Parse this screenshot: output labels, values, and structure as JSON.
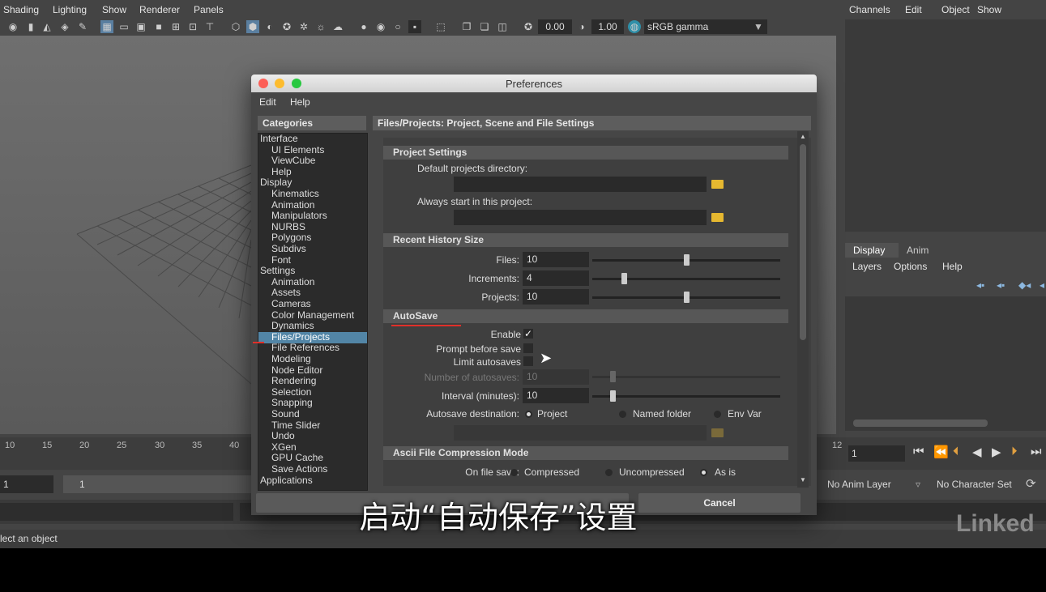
{
  "menubar": {
    "items": [
      "Shading",
      "Lighting",
      "Show",
      "Renderer",
      "Panels"
    ]
  },
  "toolbar": {
    "exposure": "0.00",
    "gamma": "1.00",
    "color_space": "sRGB gamma"
  },
  "right_panel": {
    "menu": [
      "Channels",
      "Edit",
      "Object",
      "Show"
    ],
    "tabs": [
      "Display",
      "Anim"
    ],
    "layer_menu": [
      "Layers",
      "Options",
      "Help"
    ]
  },
  "timeline": {
    "ticks": [
      "10",
      "15",
      "20",
      "25",
      "30",
      "35",
      "40"
    ],
    "right_tick": "12",
    "current_frame": "1"
  },
  "bottom_bar": {
    "start": "1",
    "range_start": "1",
    "anim_layer": "No Anim Layer",
    "character_set": "No Character Set"
  },
  "status": {
    "text": "lect an object"
  },
  "preferences": {
    "title": "Preferences",
    "menu": [
      "Edit",
      "Help"
    ],
    "categories_header": "Categories",
    "settings_header": "Files/Projects: Project, Scene and File Settings",
    "categories": [
      {
        "label": "Interface",
        "indent": 0
      },
      {
        "label": "UI Elements",
        "indent": 1
      },
      {
        "label": "ViewCube",
        "indent": 1
      },
      {
        "label": "Help",
        "indent": 1
      },
      {
        "label": "Display",
        "indent": 0
      },
      {
        "label": "Kinematics",
        "indent": 1
      },
      {
        "label": "Animation",
        "indent": 1
      },
      {
        "label": "Manipulators",
        "indent": 1
      },
      {
        "label": "NURBS",
        "indent": 1
      },
      {
        "label": "Polygons",
        "indent": 1
      },
      {
        "label": "Subdivs",
        "indent": 1
      },
      {
        "label": "Font",
        "indent": 1
      },
      {
        "label": "Settings",
        "indent": 0
      },
      {
        "label": "Animation",
        "indent": 1
      },
      {
        "label": "Assets",
        "indent": 1
      },
      {
        "label": "Cameras",
        "indent": 1
      },
      {
        "label": "Color Management",
        "indent": 1
      },
      {
        "label": "Dynamics",
        "indent": 1
      },
      {
        "label": "Files/Projects",
        "indent": 1,
        "selected": true
      },
      {
        "label": "File References",
        "indent": 1
      },
      {
        "label": "Modeling",
        "indent": 1
      },
      {
        "label": "Node Editor",
        "indent": 1
      },
      {
        "label": "Rendering",
        "indent": 1
      },
      {
        "label": "Selection",
        "indent": 1
      },
      {
        "label": "Snapping",
        "indent": 1
      },
      {
        "label": "Sound",
        "indent": 1
      },
      {
        "label": "Time Slider",
        "indent": 1
      },
      {
        "label": "Undo",
        "indent": 1
      },
      {
        "label": "XGen",
        "indent": 1
      },
      {
        "label": "GPU Cache",
        "indent": 1
      },
      {
        "label": "Save Actions",
        "indent": 1
      },
      {
        "label": "Applications",
        "indent": 0
      }
    ],
    "project_settings": {
      "title": "Project Settings",
      "default_dir_label": "Default projects directory:",
      "always_start_label": "Always start in this project:"
    },
    "recent_history": {
      "title": "Recent History Size",
      "files_label": "Files:",
      "files_value": "10",
      "files_fraction": 0.5,
      "increments_label": "Increments:",
      "increments_value": "4",
      "increments_fraction": 0.17,
      "projects_label": "Projects:",
      "projects_value": "10",
      "projects_fraction": 0.5
    },
    "autosave": {
      "title": "AutoSave",
      "enable_label": "Enable",
      "enable_checked": true,
      "prompt_label": "Prompt before save",
      "limit_label": "Limit autosaves",
      "number_label": "Number of autosaves:",
      "number_value": "10",
      "interval_label": "Interval (minutes):",
      "interval_value": "10",
      "destination_label": "Autosave destination:",
      "destination_options": [
        "Project",
        "Named folder",
        "Env Var"
      ]
    },
    "ascii": {
      "title": "Ascii File Compression Mode",
      "on_save_label": "On file save:",
      "options": [
        "Compressed",
        "Uncompressed",
        "As is"
      ]
    },
    "cancel_label": "Cancel"
  },
  "subtitle": "启动“自动保存”设置",
  "watermark": "Linked"
}
